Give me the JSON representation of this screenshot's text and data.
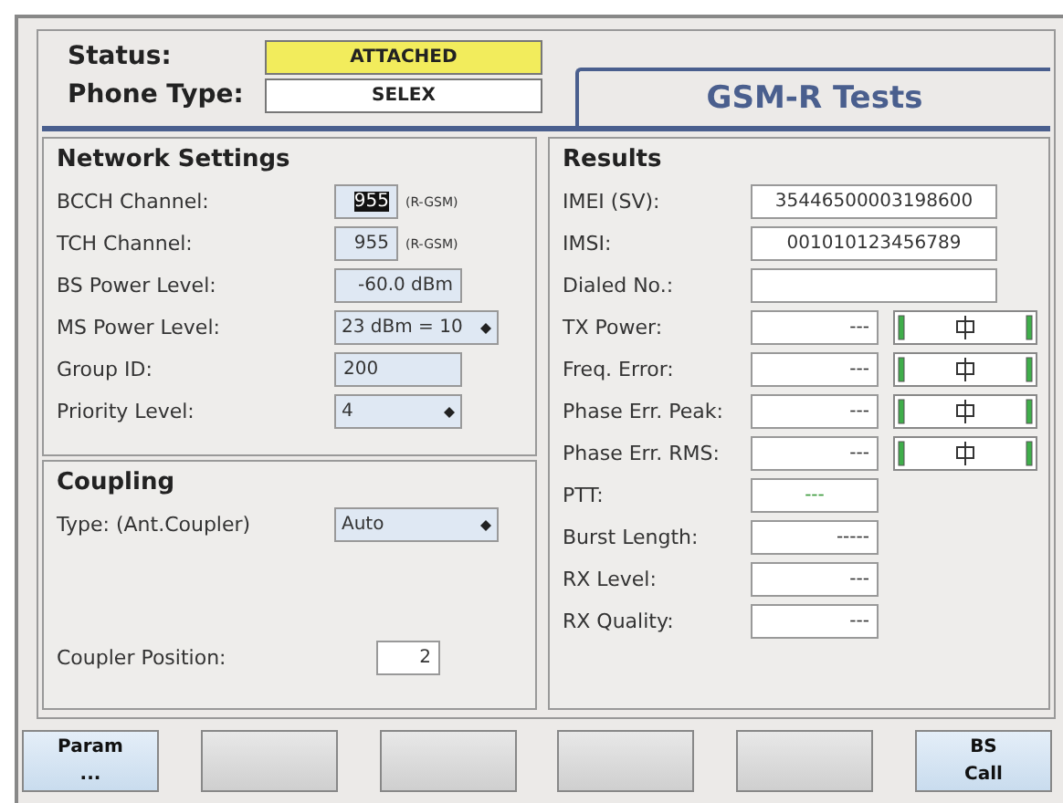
{
  "header": {
    "status": {
      "label": "Status:",
      "value": "ATTACHED"
    },
    "phone_type": {
      "label": "Phone Type:",
      "value": "SELEX"
    },
    "title": "GSM-R Tests"
  },
  "network_settings": {
    "title": "Network Settings",
    "rows": [
      {
        "label": "BCCH Channel:",
        "kind": "number",
        "value": "955",
        "unit": "(R-GSM)",
        "highlighted": true
      },
      {
        "label": "TCH Channel:",
        "kind": "number",
        "value": "955",
        "unit": "(R-GSM)",
        "highlighted": false
      },
      {
        "label": "BS Power Level:",
        "kind": "number",
        "value": "-60.0 dBm"
      },
      {
        "label": "MS Power Level:",
        "kind": "select",
        "value": "23 dBm = 10"
      },
      {
        "label": "Group ID:",
        "kind": "text",
        "value": "200"
      },
      {
        "label": "Priority Level:",
        "kind": "select",
        "value": "4"
      }
    ]
  },
  "coupling": {
    "title": "Coupling",
    "type": {
      "label": "Type: (Ant.Coupler)",
      "value": "Auto"
    },
    "position": {
      "label": "Coupler Position:",
      "value": "2"
    }
  },
  "results": {
    "title": "Results",
    "rows": [
      {
        "label": "IMEI (SV):",
        "kind": "wide",
        "value": "35446500003198600"
      },
      {
        "label": "IMSI:",
        "kind": "wide",
        "value": "001010123456789"
      },
      {
        "label": "Dialed No.:",
        "kind": "wide"
      },
      {
        "label": "TX Power:",
        "kind": "meter",
        "value": "---"
      },
      {
        "label": "Freq. Error:",
        "kind": "meter",
        "value": "---"
      },
      {
        "label": "Phase Err. Peak:",
        "kind": "meter",
        "value": "---"
      },
      {
        "label": "Phase Err. RMS:",
        "kind": "meter",
        "value": "---"
      },
      {
        "label": "PTT:",
        "kind": "indicator",
        "value": "---"
      },
      {
        "label": "Burst Length:",
        "kind": "short",
        "value": "-----"
      },
      {
        "label": "RX Level:",
        "kind": "short",
        "value": "---"
      },
      {
        "label": "RX Quality:",
        "kind": "short",
        "value": "---"
      }
    ]
  },
  "softkeys": [
    {
      "lines": [
        "Param",
        "..."
      ],
      "enabled": true
    },
    {
      "enabled": false
    },
    {
      "enabled": false
    },
    {
      "enabled": false
    },
    {
      "enabled": false
    },
    {
      "lines": [
        "BS",
        "Call"
      ],
      "enabled": true
    }
  ]
}
